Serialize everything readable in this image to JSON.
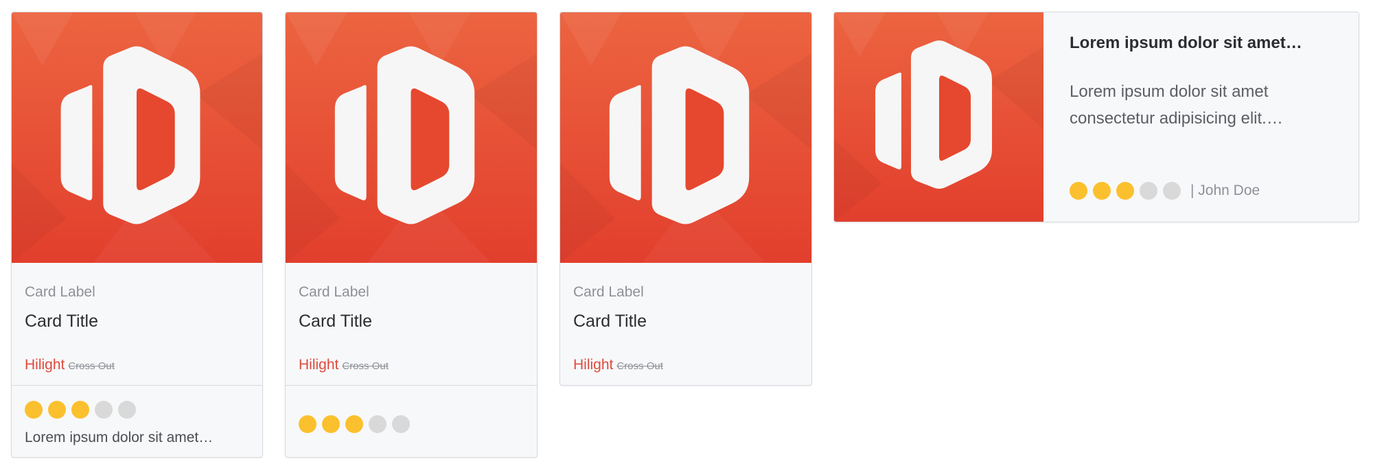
{
  "colors": {
    "accent": "#e84e34",
    "hilight": "#e04a3c",
    "star_on": "#fbc02d",
    "star_off": "#d9d9d9"
  },
  "thumbnail": {
    "icon": "hexagon-logo-icon"
  },
  "cards": [
    {
      "label": "Card Label",
      "title": "Card Title",
      "hilight": "Hilight",
      "cross_out": "Cross Out",
      "rating": 3,
      "rating_max": 5,
      "snippet": "Lorem ipsum dolor sit amet…"
    },
    {
      "label": "Card Label",
      "title": "Card Title",
      "hilight": "Hilight",
      "cross_out": "Cross Out",
      "rating": 3,
      "rating_max": 5
    },
    {
      "label": "Card Label",
      "title": "Card Title",
      "hilight": "Hilight",
      "cross_out": "Cross Out"
    }
  ],
  "horizontal_card": {
    "heading": "Lorem ipsum dolor sit amet…",
    "description": "Lorem ipsum dolor sit amet consectetur adipisicing elit.…",
    "rating": 3,
    "rating_max": 5,
    "author": "| John Doe"
  }
}
